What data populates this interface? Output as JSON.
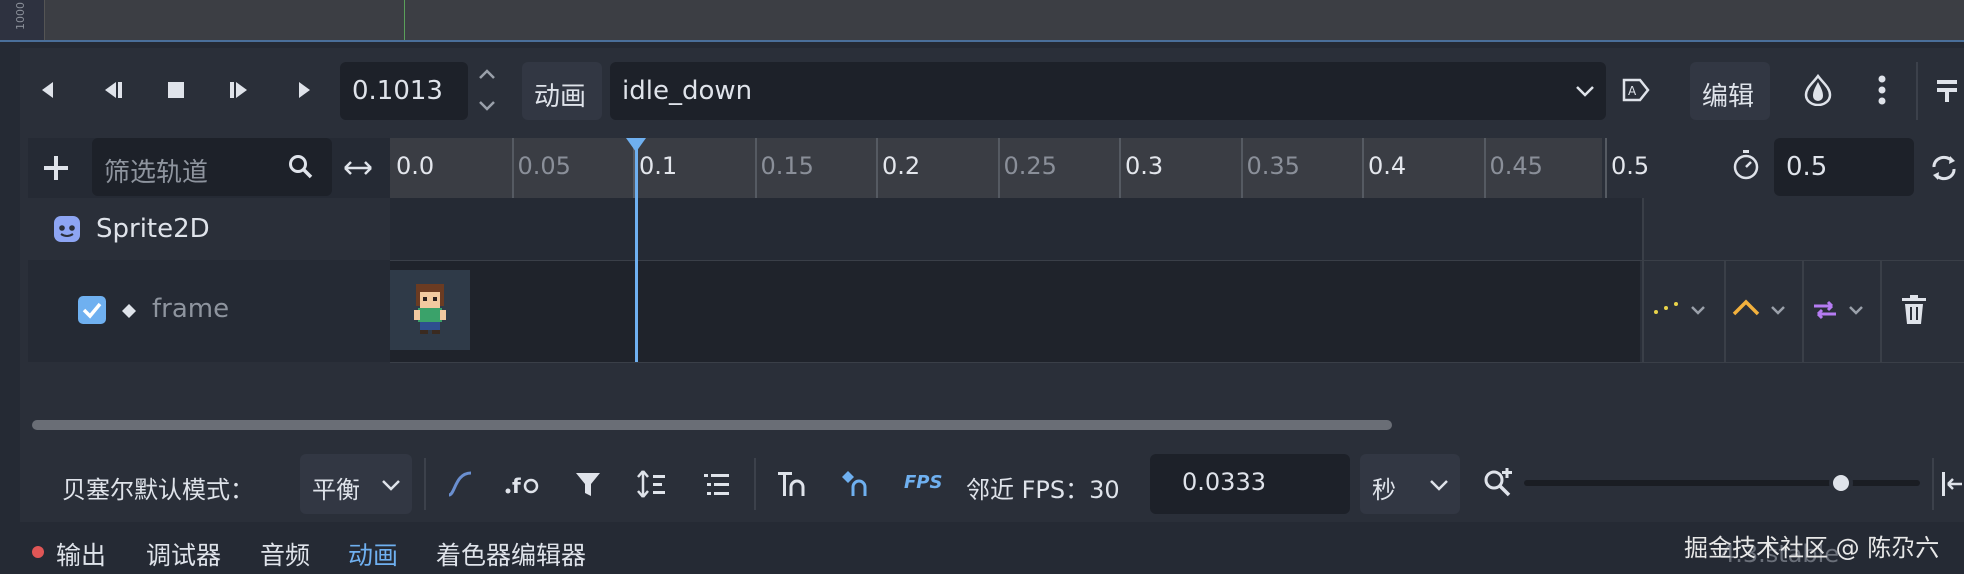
{
  "top": {
    "ruler_label": "1000"
  },
  "transport": {
    "buttons": [
      "play-backwards-from-end",
      "play-backwards",
      "stop",
      "play",
      "play-from-start"
    ],
    "time_value": "0.1013",
    "animation_label": "动画",
    "animation_select": "idle_down",
    "edit_label": "编辑"
  },
  "timeline": {
    "filter_placeholder": "筛选轨道",
    "ticks": [
      {
        "label": "0.0",
        "major": true
      },
      {
        "label": "0.05",
        "major": false
      },
      {
        "label": "0.1",
        "major": true
      },
      {
        "label": "0.15",
        "major": false
      },
      {
        "label": "0.2",
        "major": true
      },
      {
        "label": "0.25",
        "major": false
      },
      {
        "label": "0.3",
        "major": true
      },
      {
        "label": "0.35",
        "major": false
      },
      {
        "label": "0.4",
        "major": true
      },
      {
        "label": "0.45",
        "major": false
      },
      {
        "label": "0.5",
        "major": true
      }
    ],
    "length_value": "0.5",
    "playhead_time": 0.1013,
    "timeline_length": 0.5
  },
  "tracks": {
    "node_name": "Sprite2D",
    "property_name": "frame",
    "property_enabled": true
  },
  "bottom": {
    "bezier_label": "贝塞尔默认模式：",
    "bezier_mode": "平衡",
    "fps_label": "FPS",
    "snap_label": "邻近 FPS：30",
    "snap_value": "0.0333",
    "unit": "秒",
    "zoom_level": 0.8
  },
  "tabs": {
    "items": [
      "输出",
      "调试器",
      "音频",
      "动画",
      "着色器编辑器"
    ],
    "active": "动画",
    "version": "4.3.stable",
    "watermark": "掘金技术社区 @ 陈尕六"
  },
  "colors": {
    "accent": "#6fb0f0",
    "yellow": "#e8d34a",
    "orange": "#f3b13d",
    "purple": "#b57cf2",
    "error_dot": "#e05656"
  }
}
